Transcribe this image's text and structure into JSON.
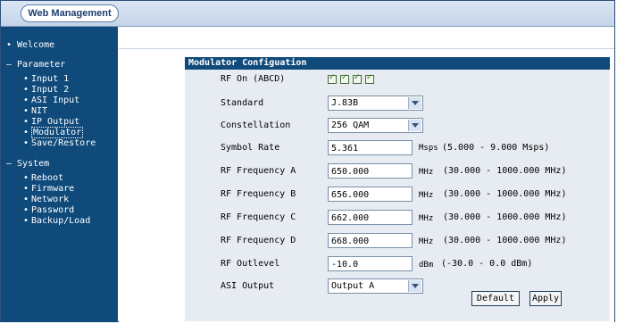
{
  "header": {
    "brand": "Web Management"
  },
  "sidebar": {
    "items": [
      {
        "bullet": "•",
        "label": "Welcome"
      },
      {
        "bullet": "–",
        "label": "Parameter"
      },
      {
        "bullet": "–",
        "label": "System"
      }
    ],
    "parameter_items": [
      "Input 1",
      "Input 2",
      "ASI Input",
      "NIT",
      "IP Output",
      "Modulator",
      "Save/Restore"
    ],
    "system_items": [
      "Reboot",
      "Firmware",
      "Network",
      "Password",
      "Backup/Load"
    ],
    "active_item": "Modulator"
  },
  "panel": {
    "title": "Modulator Configuation",
    "rf_on": {
      "label": "RF On (ABCD)",
      "checked": [
        true,
        true,
        true,
        true
      ]
    },
    "standard": {
      "label": "Standard",
      "value": "J.83B"
    },
    "constellation": {
      "label": "Constellation",
      "value": "256 QAM"
    },
    "symbol_rate": {
      "label": "Symbol Rate",
      "value": "5.361",
      "unit": "Msps",
      "range": "(5.000 - 9.000 Msps)"
    },
    "rf_a": {
      "label": "RF Frequency A",
      "value": "650.000",
      "unit": "MHz",
      "range": "(30.000 - 1000.000 MHz)"
    },
    "rf_b": {
      "label": "RF Frequency B",
      "value": "656.000",
      "unit": "MHz",
      "range": "(30.000 - 1000.000 MHz)"
    },
    "rf_c": {
      "label": "RF Frequency C",
      "value": "662.000",
      "unit": "MHz",
      "range": "(30.000 - 1000.000 MHz)"
    },
    "rf_d": {
      "label": "RF Frequency D",
      "value": "668.000",
      "unit": "MHz",
      "range": "(30.000 - 1000.000 MHz)"
    },
    "outlevel": {
      "label": "RF Outlevel",
      "value": "-10.0",
      "unit": "dBm",
      "range": "(-30.0 - 0.0 dBm)"
    },
    "asi_output": {
      "label": "ASI Output",
      "value": "Output A"
    },
    "buttons": {
      "default": "Default",
      "apply": "Apply"
    }
  },
  "colors": {
    "nav_bg": "#0f4a7b",
    "panel_bg": "#e7ecf2",
    "header_bg": "#c4d4e8"
  }
}
